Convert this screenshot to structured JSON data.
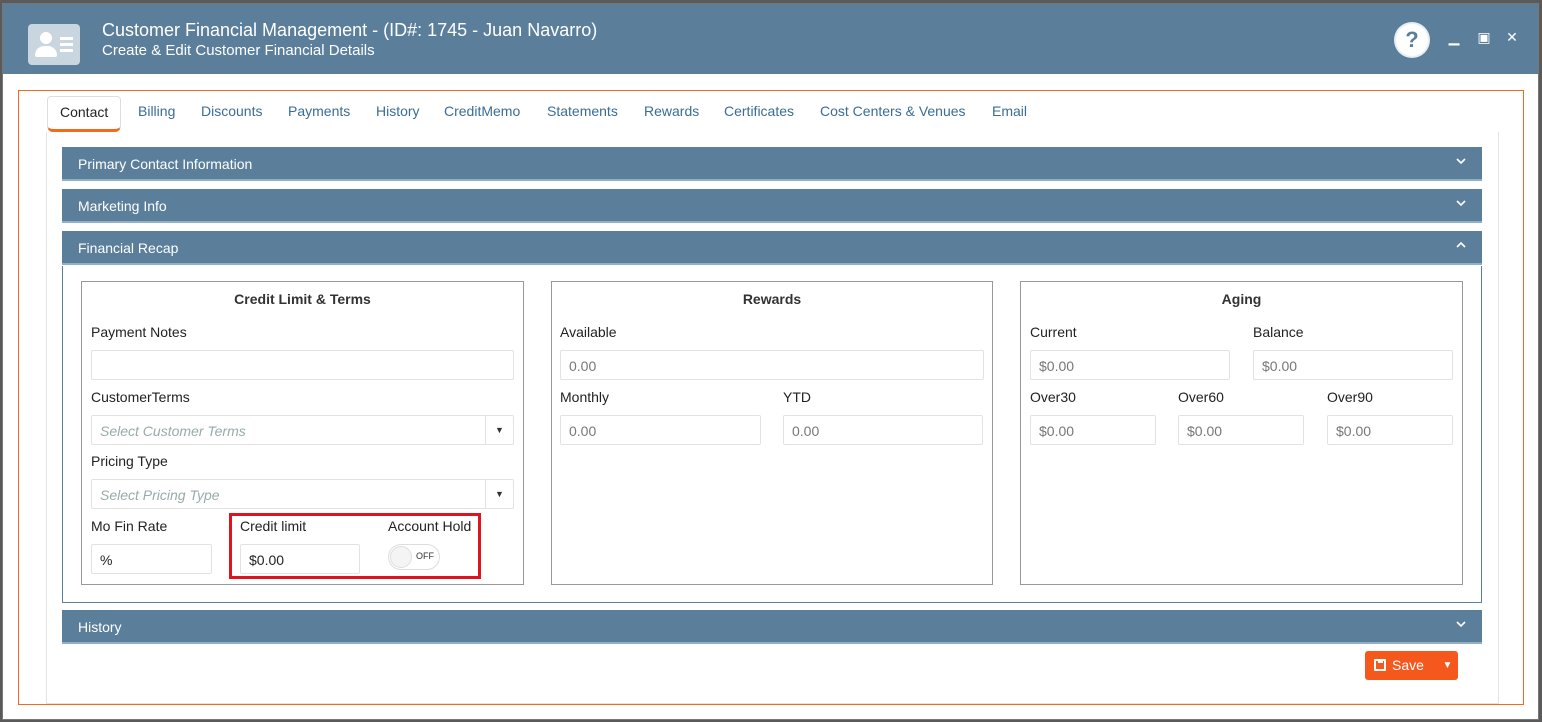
{
  "window": {
    "title": "Customer Financial Management - (ID#: 1745 - Juan Navarro)",
    "subtitle": "Create & Edit Customer Financial Details",
    "help_icon": "?",
    "minimize_icon": "▁",
    "maximize_icon": "▣",
    "close_icon": "✕"
  },
  "tabs": [
    "Contact",
    "Billing",
    "Discounts",
    "Payments",
    "History",
    "CreditMemo",
    "Statements",
    "Rewards",
    "Certificates",
    "Cost Centers & Venues",
    "Email"
  ],
  "active_tab": "Contact",
  "sections": {
    "primary_contact": "Primary Contact Information",
    "marketing": "Marketing Info",
    "financial_recap": "Financial Recap",
    "history": "History"
  },
  "credit": {
    "title": "Credit Limit & Terms",
    "payment_notes_label": "Payment Notes",
    "payment_notes_value": "",
    "customer_terms_label": "CustomerTerms",
    "customer_terms_placeholder": "Select Customer Terms",
    "pricing_type_label": "Pricing Type",
    "pricing_type_placeholder": "Select Pricing Type",
    "mo_fin_rate_label": "Mo Fin Rate",
    "mo_fin_rate_value": "%",
    "credit_limit_label": "Credit limit",
    "credit_limit_value": "$0.00",
    "account_hold_label": "Account Hold",
    "account_hold_state": "OFF"
  },
  "rewards": {
    "title": "Rewards",
    "available_label": "Available",
    "available_value": "0.00",
    "monthly_label": "Monthly",
    "monthly_value": "0.00",
    "ytd_label": "YTD",
    "ytd_value": "0.00"
  },
  "aging": {
    "title": "Aging",
    "current_label": "Current",
    "current_value": "$0.00",
    "balance_label": "Balance",
    "balance_value": "$0.00",
    "over30_label": "Over30",
    "over30_value": "$0.00",
    "over60_label": "Over60",
    "over60_value": "$0.00",
    "over90_label": "Over90",
    "over90_value": "$0.00"
  },
  "footer": {
    "save_label": "Save",
    "save_caret": "▼"
  },
  "colors": {
    "header": "#5b7f9b",
    "accent": "#f26b1d",
    "highlight": "#e0141e",
    "save": "#f5581d"
  }
}
